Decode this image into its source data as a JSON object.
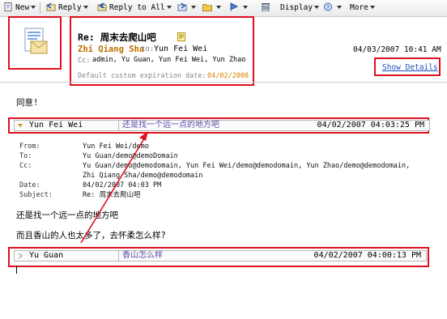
{
  "toolbar": {
    "new_label": "New",
    "reply_label": "Reply",
    "reply_all_label": "Reply to All",
    "display_label": "Display",
    "more_label": "More"
  },
  "header": {
    "subject": "Re: 周末去爬山吧",
    "from": "Zhi Qiang Sha",
    "to_label": "to:",
    "to": "Yun Fei Wei",
    "cc_label": "Cc:",
    "cc": "admin, Yu Guan, Yun Fei Wei, Yun Zhao",
    "expiration_label": "Default custom expiration date:",
    "expiration_value": "04/02/2008",
    "date": "04/03/2007 10:41 AM",
    "show_details": "Show Details"
  },
  "body": {
    "text": "同意!"
  },
  "thread": [
    {
      "sender": "Yun Fei Wei",
      "subject": "还是找一个远一点的地方吧",
      "date": "04/02/2007 04:03:25 PM",
      "expanded": true,
      "details": {
        "from_label": "From:",
        "from": "Yun Fei Wei/demo",
        "to_label": "To:",
        "to": "Yu Guan/demo@demoDomain",
        "cc_label": "Cc:",
        "cc": "Yu Guan/demo@demodomain, Yun Fei Wei/demo@demodomain, Yun Zhao/demo@demodomain, Zhi Qiang Sha/demo@demodomain",
        "date_label": "Date:",
        "date": "04/02/2007 04:03 PM",
        "subject_label": "Subject:",
        "subject": "Re: 周末去爬山吧"
      },
      "body_lines": [
        "还是找一个远一点的地方吧",
        "而且香山的人也太多了，去怀柔怎么样?"
      ]
    },
    {
      "sender": "Yu Guan",
      "subject": "香山怎么样",
      "date": "04/02/2007 04:00:13 PM",
      "expanded": false
    }
  ],
  "colors": {
    "highlight_border": "#e0101e",
    "sender_color": "#c07000",
    "thread_subject_color": "#5a4ba8",
    "link_color": "#1e4fbd"
  }
}
